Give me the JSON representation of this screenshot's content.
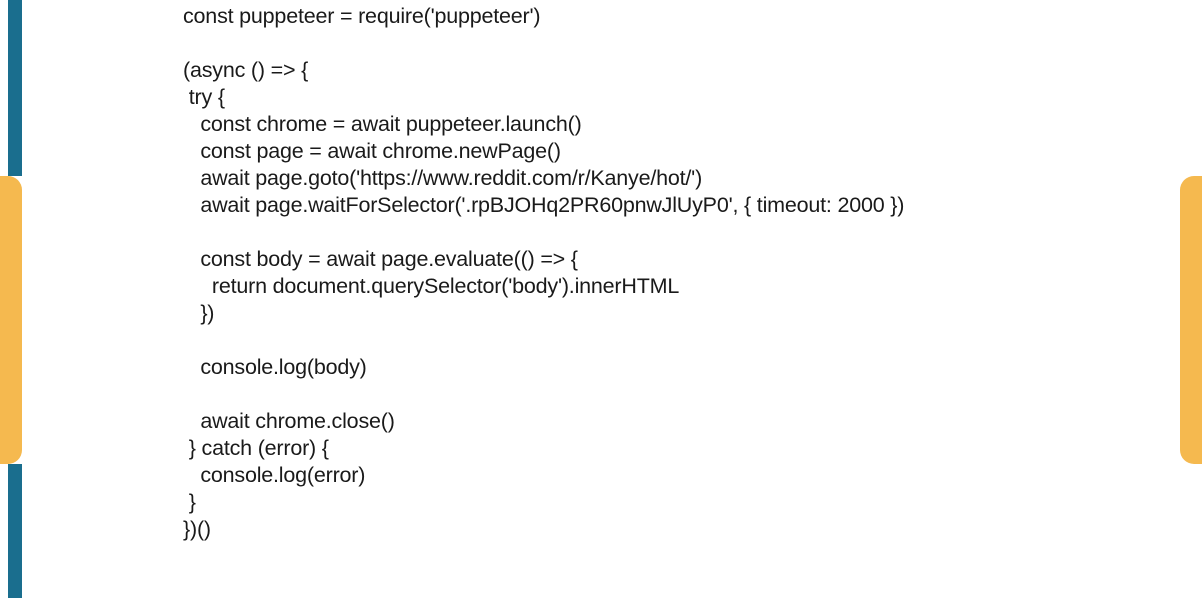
{
  "code": {
    "line1": "const puppeteer = require('puppeteer')",
    "line2": "",
    "line3": "(async () => {",
    "line4": " try {",
    "line5": "   const chrome = await puppeteer.launch()",
    "line6": "   const page = await chrome.newPage()",
    "line7": "   await page.goto('https://www.reddit.com/r/Kanye/hot/')",
    "line8": "   await page.waitForSelector('.rpBJOHq2PR60pnwJlUyP0', { timeout: 2000 })",
    "line9": "",
    "line10": "   const body = await page.evaluate(() => {",
    "line11": "     return document.querySelector('body').innerHTML",
    "line12": "   })",
    "line13": "",
    "line14": "   console.log(body)",
    "line15": "",
    "line16": "   await chrome.close()",
    "line17": " } catch (error) {",
    "line18": "   console.log(error)",
    "line19": " }",
    "line20": "})()"
  }
}
